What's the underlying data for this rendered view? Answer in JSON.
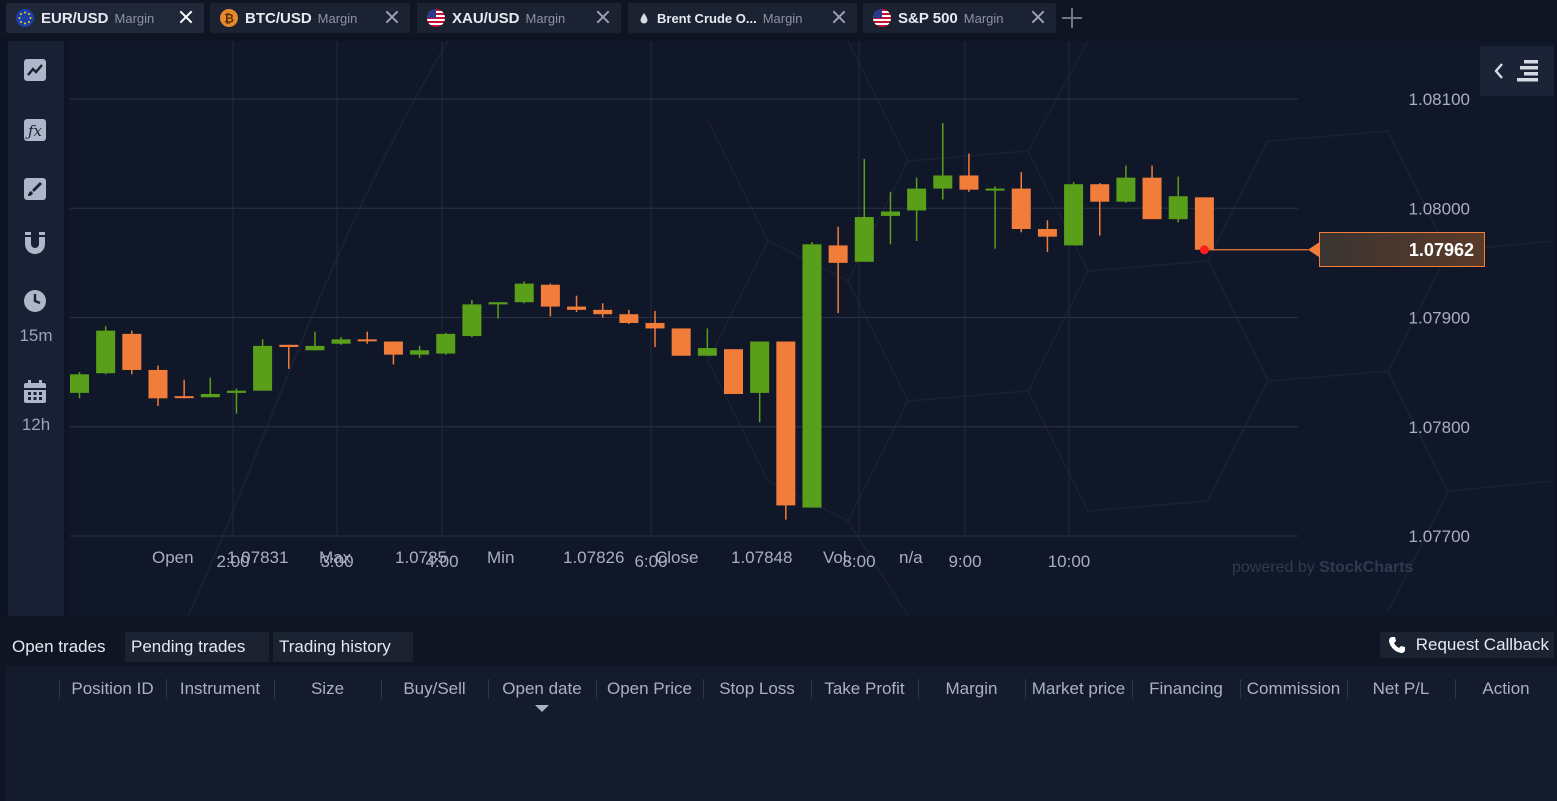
{
  "tabs": [
    {
      "symbol": "EUR/USD",
      "type": "Margin",
      "active": true,
      "flag": "eu-flag-icon"
    },
    {
      "symbol": "BTC/USD",
      "type": "Margin",
      "active": false,
      "flag": "bitcoin-icon"
    },
    {
      "symbol": "XAU/USD",
      "type": "Margin",
      "active": false,
      "flag": "us-flag-icon"
    },
    {
      "symbol": "Brent Crude O...",
      "type": "Margin",
      "active": false,
      "flag": "oil-drop-icon"
    },
    {
      "symbol": "S&P 500",
      "type": "Margin",
      "active": false,
      "flag": "us-flag-icon"
    }
  ],
  "toolbar": {
    "interval": "15m",
    "period": "12h",
    "icons": [
      "line-chart-icon",
      "indicator-fx-icon",
      "brush-icon",
      "magnet-icon",
      "clock-icon",
      "calendar-icon"
    ]
  },
  "chart": {
    "current_price": "1.07962",
    "watermark_prefix": "powered by",
    "watermark_brand": "StockCharts",
    "ohlc": {
      "open_label": "Open",
      "open": "1.07831",
      "max_label": "Max",
      "max": "1.0785",
      "min_label": "Min",
      "min": "1.07826",
      "close_label": "Close",
      "close": "1.07848",
      "vol_label": "Vol.",
      "vol": "n/a"
    },
    "colors": {
      "up": "#5a9f1a",
      "down": "#f27d3b",
      "current": "#ff1e1e"
    }
  },
  "chart_data": {
    "type": "candlestick",
    "title": "",
    "ylim": [
      1.0768,
      1.0817
    ],
    "y_ticks": [
      "1.08100",
      "1.08000",
      "1.07900",
      "1.07800",
      "1.07700"
    ],
    "x_ticks": [
      "2:00",
      "3:00",
      "4:00",
      "6:00",
      "8:00",
      "9:00",
      "10:00"
    ],
    "candles": [
      {
        "o": 1.07831,
        "h": 1.0785,
        "l": 1.07826,
        "c": 1.07848
      },
      {
        "o": 1.07849,
        "h": 1.07892,
        "l": 1.07848,
        "c": 1.07888
      },
      {
        "o": 1.07885,
        "h": 1.07888,
        "l": 1.07848,
        "c": 1.07852
      },
      {
        "o": 1.07852,
        "h": 1.07856,
        "l": 1.07819,
        "c": 1.07826
      },
      {
        "o": 1.07828,
        "h": 1.07843,
        "l": 1.07826,
        "c": 1.07827
      },
      {
        "o": 1.07827,
        "h": 1.07845,
        "l": 1.07827,
        "c": 1.0783
      },
      {
        "o": 1.07831,
        "h": 1.07835,
        "l": 1.07812,
        "c": 1.07833
      },
      {
        "o": 1.07833,
        "h": 1.0788,
        "l": 1.07833,
        "c": 1.07874
      },
      {
        "o": 1.07875,
        "h": 1.07875,
        "l": 1.07853,
        "c": 1.07873
      },
      {
        "o": 1.0787,
        "h": 1.07887,
        "l": 1.0787,
        "c": 1.07874
      },
      {
        "o": 1.07876,
        "h": 1.07882,
        "l": 1.07875,
        "c": 1.0788
      },
      {
        "o": 1.0788,
        "h": 1.07887,
        "l": 1.07876,
        "c": 1.07879
      },
      {
        "o": 1.07878,
        "h": 1.07878,
        "l": 1.07857,
        "c": 1.07866
      },
      {
        "o": 1.07866,
        "h": 1.07874,
        "l": 1.07863,
        "c": 1.0787
      },
      {
        "o": 1.07867,
        "h": 1.07886,
        "l": 1.07866,
        "c": 1.07885
      },
      {
        "o": 1.07883,
        "h": 1.07916,
        "l": 1.07882,
        "c": 1.07912
      },
      {
        "o": 1.07912,
        "h": 1.07914,
        "l": 1.07899,
        "c": 1.07914
      },
      {
        "o": 1.07914,
        "h": 1.07933,
        "l": 1.07913,
        "c": 1.07931
      },
      {
        "o": 1.0793,
        "h": 1.07931,
        "l": 1.07901,
        "c": 1.0791
      },
      {
        "o": 1.0791,
        "h": 1.0792,
        "l": 1.07905,
        "c": 1.07907
      },
      {
        "o": 1.07907,
        "h": 1.07913,
        "l": 1.079,
        "c": 1.07903
      },
      {
        "o": 1.07903,
        "h": 1.07907,
        "l": 1.07894,
        "c": 1.07895
      },
      {
        "o": 1.07895,
        "h": 1.07906,
        "l": 1.07873,
        "c": 1.0789
      },
      {
        "o": 1.0789,
        "h": 1.0789,
        "l": 1.07865,
        "c": 1.07865
      },
      {
        "o": 1.07865,
        "h": 1.0789,
        "l": 1.07865,
        "c": 1.07872
      },
      {
        "o": 1.07871,
        "h": 1.07871,
        "l": 1.0783,
        "c": 1.0783
      },
      {
        "o": 1.07831,
        "h": 1.07877,
        "l": 1.07804,
        "c": 1.07878
      },
      {
        "o": 1.07878,
        "h": 1.07878,
        "l": 1.07715,
        "c": 1.07728
      },
      {
        "o": 1.07726,
        "h": 1.07969,
        "l": 1.07726,
        "c": 1.07967
      },
      {
        "o": 1.07966,
        "h": 1.07983,
        "l": 1.07904,
        "c": 1.0795
      },
      {
        "o": 1.07951,
        "h": 1.08045,
        "l": 1.07951,
        "c": 1.07992
      },
      {
        "o": 1.07993,
        "h": 1.08015,
        "l": 1.07967,
        "c": 1.07997
      },
      {
        "o": 1.07998,
        "h": 1.08028,
        "l": 1.0797,
        "c": 1.08018
      },
      {
        "o": 1.08018,
        "h": 1.08078,
        "l": 1.08008,
        "c": 1.0803
      },
      {
        "o": 1.0803,
        "h": 1.0805,
        "l": 1.08015,
        "c": 1.08017
      },
      {
        "o": 1.08017,
        "h": 1.0802,
        "l": 1.07963,
        "c": 1.08018
      },
      {
        "o": 1.08018,
        "h": 1.08033,
        "l": 1.07978,
        "c": 1.07981
      },
      {
        "o": 1.07981,
        "h": 1.07989,
        "l": 1.0796,
        "c": 1.07974
      },
      {
        "o": 1.07966,
        "h": 1.08024,
        "l": 1.07966,
        "c": 1.08022
      },
      {
        "o": 1.08022,
        "h": 1.08023,
        "l": 1.07975,
        "c": 1.08006
      },
      {
        "o": 1.08006,
        "h": 1.08039,
        "l": 1.08005,
        "c": 1.08028
      },
      {
        "o": 1.08028,
        "h": 1.08039,
        "l": 1.0799,
        "c": 1.0799
      },
      {
        "o": 1.0799,
        "h": 1.08029,
        "l": 1.07987,
        "c": 1.08011
      },
      {
        "o": 1.0801,
        "h": 1.0801,
        "l": 1.07962,
        "c": 1.07962
      }
    ]
  },
  "bottom_tabs": [
    "Open trades",
    "Pending trades",
    "Trading history"
  ],
  "callback_label": "Request Callback",
  "table_headers": [
    "Position ID",
    "Instrument",
    "Size",
    "Buy/Sell",
    "Open date",
    "Open Price",
    "Stop Loss",
    "Take Profit",
    "Margin",
    "Market price",
    "Financing",
    "Commission",
    "Net P/L",
    "Action"
  ]
}
